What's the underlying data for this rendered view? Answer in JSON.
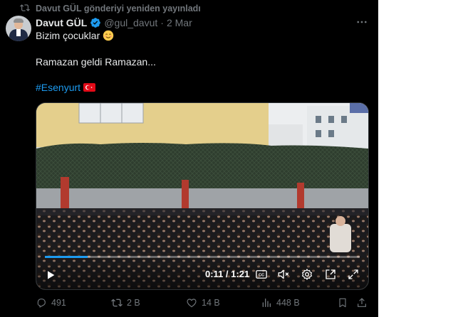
{
  "repost": {
    "text": "Davut GÜL gönderiyi yeniden yayınladı"
  },
  "author": {
    "name": "Davut GÜL",
    "handle": "@gul_davut",
    "separator": "·",
    "date": "2 Mar"
  },
  "tweet": {
    "line1": "Bizim çocuklar",
    "line1_emoji": "😊",
    "line2": "Ramazan geldi Ramazan...",
    "hashtag": "#Esenyurt"
  },
  "video": {
    "time": "0:11 / 1:21",
    "progress": 0.136
  },
  "stats": {
    "replies": "491",
    "reposts": "2 B",
    "likes": "14 B",
    "views": "448 B"
  },
  "icons": {
    "repost": "repost-icon",
    "verified": "verified-badge-icon",
    "more": "more-options-icon",
    "play": "play-icon",
    "captions": "captions-icon",
    "mute": "mute-icon",
    "settings": "gear-icon",
    "pip": "picture-in-picture-icon",
    "fullscreen": "fullscreen-icon",
    "reply": "reply-icon",
    "like": "heart-icon",
    "views": "views-chart-icon",
    "bookmark": "bookmark-icon",
    "share": "share-icon"
  },
  "colors": {
    "background": "#000000",
    "text": "#e7e9ea",
    "muted": "#71767b",
    "accent": "#1d9bf0"
  }
}
